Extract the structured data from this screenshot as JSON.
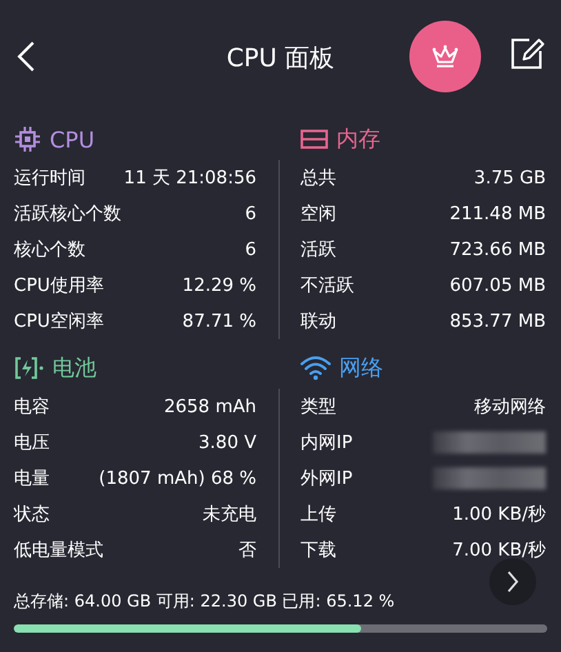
{
  "header": {
    "title": "CPU 面板"
  },
  "sections": [
    {
      "title": "CPU",
      "kind": "chip",
      "color": "#b48ee0",
      "rows": [
        {
          "label": "运行时间",
          "value": "11 天 21:08:56",
          "kind": "text"
        },
        {
          "label": "活跃核心个数",
          "value": "6",
          "kind": "text"
        },
        {
          "label": "核心个数",
          "value": "6",
          "kind": "text"
        },
        {
          "label": "CPU使用率",
          "value": "12.29 %",
          "kind": "text"
        },
        {
          "label": "CPU空闲率",
          "value": "87.71 %",
          "kind": "text"
        }
      ]
    },
    {
      "title": "内存",
      "kind": "memory",
      "color": "#e8658f",
      "rows": [
        {
          "label": "总共",
          "value": "3.75 GB",
          "kind": "text"
        },
        {
          "label": "空闲",
          "value": "211.48 MB",
          "kind": "text"
        },
        {
          "label": "活跃",
          "value": "723.66 MB",
          "kind": "text"
        },
        {
          "label": "不活跃",
          "value": "607.05 MB",
          "kind": "text"
        },
        {
          "label": "联动",
          "value": "853.77 MB",
          "kind": "text"
        }
      ]
    },
    {
      "title": "电池",
      "kind": "battery",
      "color": "#72c99a",
      "rows": [
        {
          "label": "电容",
          "value": "2658 mAh",
          "kind": "text"
        },
        {
          "label": "电压",
          "value": "3.80 V",
          "kind": "text"
        },
        {
          "label": "电量",
          "value": "(1807 mAh) 68 %",
          "kind": "text"
        },
        {
          "label": "状态",
          "value": "未充电",
          "kind": "text"
        },
        {
          "label": "低电量模式",
          "value": "否",
          "kind": "text"
        }
      ]
    },
    {
      "title": "网络",
      "kind": "wifi",
      "color": "#4a9ff0",
      "rows": [
        {
          "label": "类型",
          "value": "移动网络",
          "kind": "text"
        },
        {
          "label": "内网IP",
          "kind": "redacted"
        },
        {
          "label": "外网IP",
          "kind": "redacted"
        },
        {
          "label": "上传",
          "value": "1.00 KB/秒",
          "kind": "text"
        },
        {
          "label": "下载",
          "value": "7.00 KB/秒",
          "kind": "text"
        }
      ]
    }
  ],
  "storage": {
    "text": "总存储: 64.00 GB 可用: 22.30 GB 已用: 65.12 %",
    "level": 0.65
  }
}
